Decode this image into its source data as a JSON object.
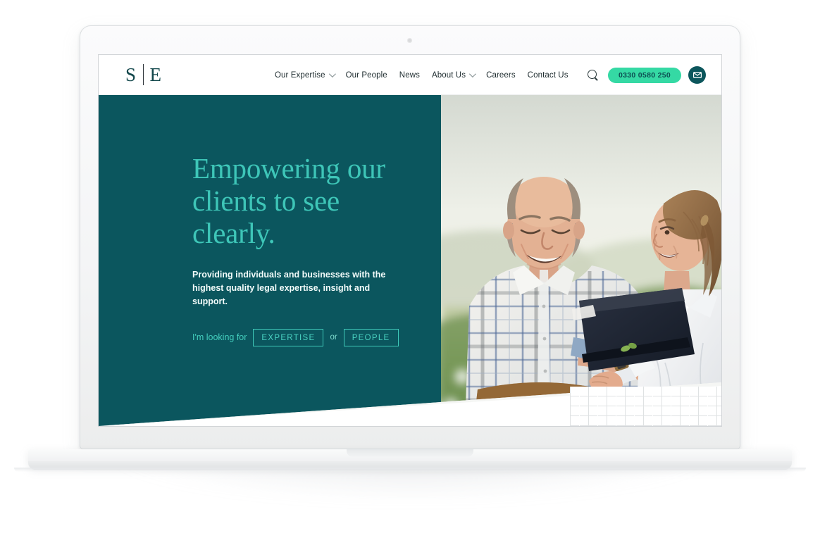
{
  "device": {
    "type": "laptop-mockup",
    "webcam": "webcam-dot"
  },
  "site": {
    "logo": {
      "left_letter": "S",
      "right_letter": "E",
      "divider": "vertical-bar"
    },
    "nav": [
      {
        "label": "Our Expertise",
        "has_dropdown": true
      },
      {
        "label": "Our People",
        "has_dropdown": false
      },
      {
        "label": "News",
        "has_dropdown": false
      },
      {
        "label": "About Us",
        "has_dropdown": true
      },
      {
        "label": "Careers",
        "has_dropdown": false
      },
      {
        "label": "Contact Us",
        "has_dropdown": false
      }
    ],
    "header_actions": {
      "search_icon": "search-icon",
      "phone": "0330 0580 250",
      "mail_icon": "envelope-icon"
    },
    "hero": {
      "title_line1": "Empowering our",
      "title_line2": "clients to see",
      "title_line3": "clearly.",
      "subtitle": "Providing individuals and businesses with the highest quality legal expertise, insight and support.",
      "cta_label": "I'm looking for",
      "cta_primary": "EXPERTISE",
      "cta_conjunction": "or",
      "cta_secondary": "PEOPLE",
      "image_alt": "Two people standing outdoors in a field, a man in a plaid shirt smiling and a woman in a white shirt holding a dark navy folder"
    }
  },
  "colors": {
    "teal_dark": "#0b565e",
    "teal_deep": "#0c565c",
    "mint_bright": "#35d9a4",
    "mint_accent": "#3ec6b8",
    "logo_ink": "#12474b",
    "nav_ink": "#1d2b2e",
    "white": "#ffffff",
    "bezel": "#f4f5f6"
  }
}
